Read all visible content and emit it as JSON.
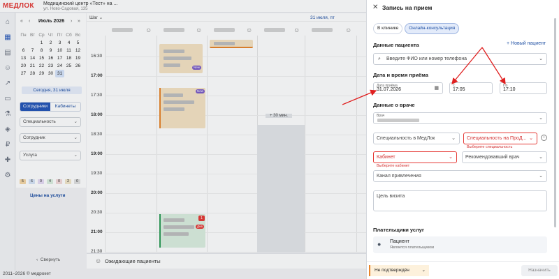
{
  "header": {
    "logo": "МЕДЛОК",
    "clinic_name": "Медицинский центр «Тест» на ...",
    "clinic_address": "ул. Ново-Садовая, 135"
  },
  "calendar": {
    "month_label": "Июль 2026",
    "weekdays": [
      "Пн",
      "Вт",
      "Ср",
      "Чт",
      "Пт",
      "Сб",
      "Вс"
    ],
    "weeks": [
      [
        "",
        "",
        "1",
        "2",
        "3",
        "4",
        "5"
      ],
      [
        "6",
        "7",
        "8",
        "9",
        "10",
        "11",
        "12"
      ],
      [
        "13",
        "14",
        "15",
        "16",
        "17",
        "18",
        "19"
      ],
      [
        "20",
        "21",
        "22",
        "23",
        "24",
        "25",
        "26"
      ],
      [
        "27",
        "28",
        "29",
        "30",
        "31",
        "",
        ""
      ]
    ],
    "selected_day": "31",
    "today_label": "Сегодня, 31 июля"
  },
  "sidebar": {
    "seg_employees": "Сотрудники",
    "seg_rooms": "Кабинеты",
    "filter_specialty": "Специальность",
    "filter_employee": "Сотрудник",
    "filter_service": "Услуга",
    "chips": [
      {
        "label": "5",
        "color": "#f6d7a7"
      },
      {
        "label": "6",
        "color": "#d7e4f7"
      },
      {
        "label": "0",
        "color": "#e6dcf5"
      },
      {
        "label": "4",
        "color": "#dcefe0"
      },
      {
        "label": "0",
        "color": "#f4d9d9"
      },
      {
        "label": "2",
        "color": "#f2e6c9"
      },
      {
        "label": "0",
        "color": "#e0e0e0"
      }
    ],
    "prices_button": "Цены на услуги",
    "collapse_label": "Свернуть",
    "copyright": "2011–2026 © медрокет"
  },
  "schedule": {
    "step_label": "Шаг",
    "date_label": "31 июля, пт",
    "times": [
      "16:30",
      "17:00",
      "17:30",
      "18:00",
      "18:30",
      "19:00",
      "19:30",
      "20:00",
      "20:30",
      "21:00",
      "21:30"
    ],
    "bold_times": [
      "17:00",
      "18:00",
      "19:00",
      "20:00",
      "21:00"
    ],
    "slot_label": "+ 30 мин.",
    "badge_new": "New",
    "badge_day": "Днв",
    "count_badge": "1",
    "waiting_label": "Ожидающие пациенты"
  },
  "modal": {
    "title": "Запись на прием",
    "tab_clinic": "В клинике",
    "tab_online": "Онлайн-консультация",
    "section_patient": "Данные пациента",
    "new_patient_link": "+ Новый пациент",
    "patient_search_placeholder": "Введите ФИО или номер телефона",
    "section_datetime": "Дата и время приёма",
    "date_label": "Дата приёма",
    "date_value": "31.07.2026",
    "from_label": "С",
    "from_value": "17:05",
    "to_label": "По",
    "to_value": "17:10",
    "section_doctor": "Данные о враче",
    "doctor_label": "Врач",
    "specialty_medlok": "Специальность в МедЛок",
    "specialty_prodoctors": "Специальность на ПроД...",
    "specialty_error": "Выберите специальность",
    "room_placeholder": "Кабинет",
    "room_error": "Выберите кабинет",
    "referring_doctor": "Рекомендовавший врач",
    "channel": "Канал привлечения",
    "visit_goal": "Цель визита",
    "section_payers": "Плательщики услуг",
    "payer_name": "Пациент",
    "payer_sub": "Является плательщиком",
    "status": "Не подтверждён",
    "assign_button": "Назначить"
  },
  "colors": {
    "accent": "#2355b8",
    "error": "#e53935",
    "arrow": "#e02020",
    "appt_orange": "#f6e3c4",
    "appt_green": "#dcefe0"
  }
}
